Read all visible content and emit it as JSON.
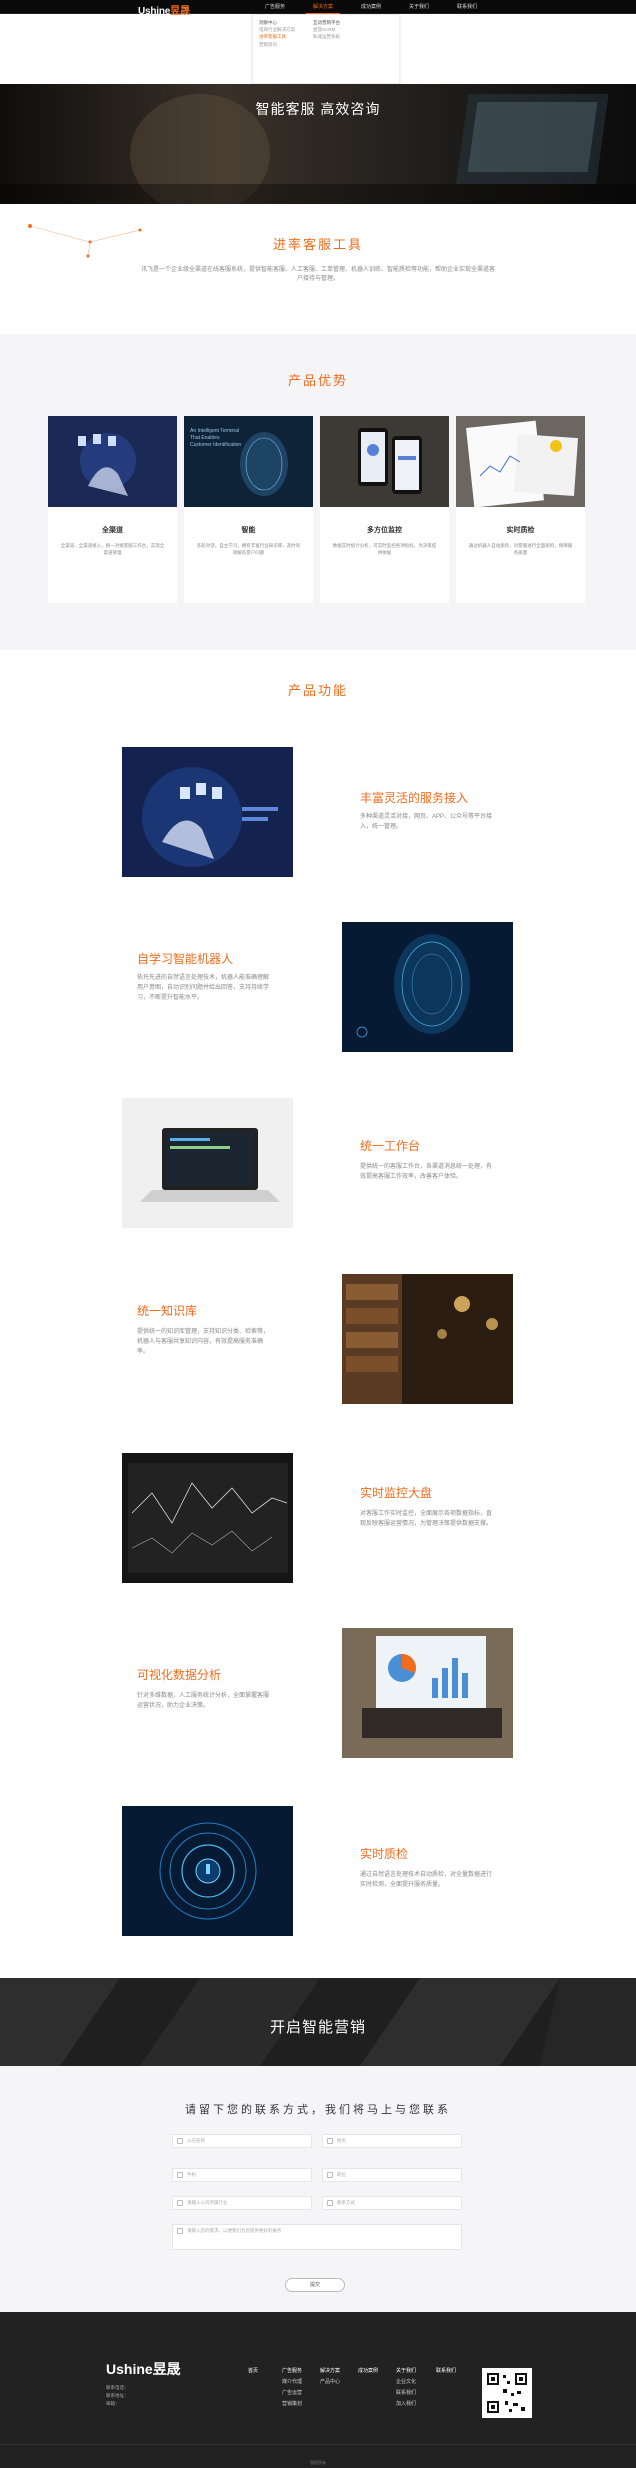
{
  "header": {
    "logo_latin": "Ushine",
    "logo_cn": "昱晟",
    "nav": [
      "广告服务",
      "解决方案",
      "成功案例",
      "关于我们",
      "联系我们"
    ]
  },
  "dropdown": {
    "col1": [
      "洞察中心",
      "电商行业解决方案",
      "进率客服工具",
      "营销资讯"
    ],
    "col2": [
      "互动营销平台",
      "昱晟SCRM",
      "私域运营系统"
    ]
  },
  "hero": {
    "title": "智能客服 高效咨询"
  },
  "intro": {
    "title": "进率客服工具",
    "text": "讯飞是一个企业级全渠道在线客服系统，提供智能客服、人工客服、工单管理、机器人训练、智能质检等功能，帮助企业实现全渠道客户接待与管理。"
  },
  "advantages": {
    "title": "产品优势",
    "cards": [
      {
        "title": "全渠道",
        "desc": "全渠道、全渠道接入，统一对接客服工作台，实现全渠道管理"
      },
      {
        "title": "智能",
        "desc": "多轮对话，自主学习，拥有丰富行业知识库，及时有效解答客户问题"
      },
      {
        "title": "多方位监控",
        "desc": "数据实时统计分析，可实时监控各项指标，为决策提供依据"
      },
      {
        "title": "实时质检",
        "desc": "通过机器人自动质检，对客服进行全面质检，保障服务质量"
      }
    ]
  },
  "features": {
    "title": "产品功能",
    "items": [
      {
        "title": "丰富灵活的服务接入",
        "desc": "多种渠道灵活对接，网页、APP、公众号等平台接入，统一管理。"
      },
      {
        "title": "自学习智能机器人",
        "desc": "依托先进的自然语言处理技术，机器人能准确理解用户意图，自动识别问题并给出回答，支持持续学习，不断提升智能水平。"
      },
      {
        "title": "统一工作台",
        "desc": "提供统一的客服工作台，各渠道消息统一处理，有效提高客服工作效率，改善客户体验。"
      },
      {
        "title": "统一知识库",
        "desc": "提供统一的知识库管理，支持知识分类、检索等，机器人与客服共享知识内容，有效提高服务准确率。"
      },
      {
        "title": "实时监控大盘",
        "desc": "对客服工作实时监控，全面展示各项数据指标，直观反映客服运营情况，为管理决策提供数据支撑。"
      },
      {
        "title": "可视化数据分析",
        "desc": "针对多维数据，人工服务统计分析，全面掌握客服运营状况，助力企业决策。"
      },
      {
        "title": "实时质检",
        "desc": "通过自然语言处理技术自动质检，对全量数据进行实时检测，全面提升服务质量。"
      }
    ]
  },
  "banner": {
    "title": "开启智能营销"
  },
  "form": {
    "title": "请留下您的联系方式，我们将马上与您联系",
    "fields": [
      "公司名称",
      "姓名",
      "手机",
      "职位",
      "请输入公司所属行业",
      "联系方式",
      "请输入您的需求，以便我们为您提供更好的服务"
    ],
    "submit": "提交"
  },
  "footer": {
    "logo_latin": "Ushine",
    "logo_cn": "昱晟",
    "info": [
      "联系电话：",
      "联系地址：",
      "邮箱："
    ],
    "columns": [
      [
        "首页"
      ],
      [
        "广告服务",
        "媒介代理",
        "广告运营",
        "营销策划"
      ],
      [
        "解决方案",
        "产品中心"
      ],
      [
        "成功案例"
      ],
      [
        "关于我们",
        "企业文化",
        "联系我们",
        "加入我们"
      ],
      [
        "联系我们"
      ]
    ],
    "copyright": "版权所有"
  },
  "colors": {
    "accent": "#f26c1c",
    "dark": "#222222",
    "light_bg": "#f5f5f7"
  }
}
